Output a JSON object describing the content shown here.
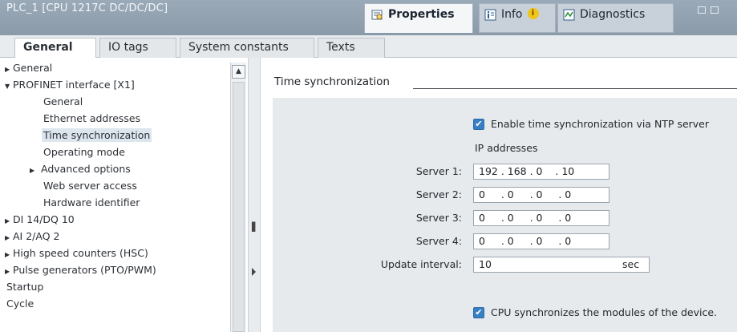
{
  "window": {
    "title": "PLC_1 [CPU 1217C DC/DC/DC]",
    "tabs": [
      {
        "label": "Properties"
      },
      {
        "label": "Info"
      },
      {
        "label": "Diagnostics"
      }
    ],
    "info_badge": "i"
  },
  "subtabs": [
    "General",
    "IO tags",
    "System constants",
    "Texts"
  ],
  "tree": [
    {
      "label": "General",
      "arrow": "▶"
    },
    {
      "label": "PROFINET interface [X1]",
      "arrow": "▼"
    },
    {
      "label": "General"
    },
    {
      "label": "Ethernet addresses"
    },
    {
      "label": "Time synchronization"
    },
    {
      "label": "Operating mode"
    },
    {
      "label": "Advanced options",
      "arrow": "▶"
    },
    {
      "label": "Web server access"
    },
    {
      "label": "Hardware identifier"
    },
    {
      "label": "DI 14/DQ 10",
      "arrow": "▶"
    },
    {
      "label": "AI 2/AQ 2",
      "arrow": "▶"
    },
    {
      "label": "High speed counters (HSC)",
      "arrow": "▶"
    },
    {
      "label": "Pulse generators (PTO/PWM)",
      "arrow": "▶"
    },
    {
      "label": "Startup"
    },
    {
      "label": "Cycle"
    }
  ],
  "section": {
    "title": "Time synchronization",
    "enable_ntp": {
      "label": "Enable time synchronization via NTP server",
      "checked": true
    },
    "ip_heading": "IP addresses",
    "servers": [
      {
        "label": "Server 1:",
        "value": "192 . 168 . 0    . 10"
      },
      {
        "label": "Server 2:",
        "value": "0     . 0     . 0     . 0"
      },
      {
        "label": "Server 3:",
        "value": "0     . 0     . 0     . 0"
      },
      {
        "label": "Server 4:",
        "value": "0     . 0     . 0     . 0"
      }
    ],
    "update_interval": {
      "label": "Update interval:",
      "value": "10",
      "unit": "sec"
    },
    "cpu_sync": {
      "label": "CPU synchronizes the modules of the device.",
      "checked": true
    }
  }
}
